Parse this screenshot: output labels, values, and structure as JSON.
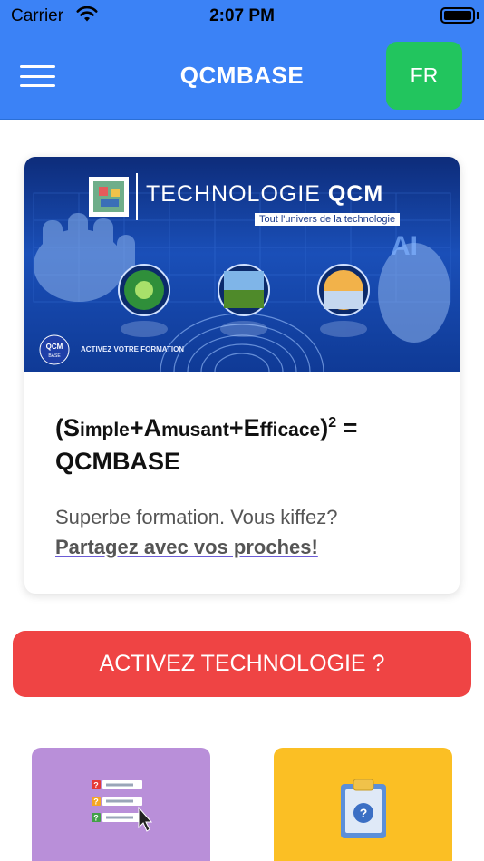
{
  "status_bar": {
    "carrier": "Carrier",
    "time": "2:07 PM",
    "battery_level": 1.0
  },
  "navbar": {
    "title": "QCMBASE",
    "menu_icon": "hamburger-menu-icon",
    "language_label": "FR",
    "language_color": "#22c55e",
    "background_color": "#3b82f6"
  },
  "card": {
    "banner": {
      "title_light": "TECHNOLOGIE ",
      "title_bold": "QCM",
      "subtitle": "Tout l'univers de la technologie",
      "cta": "ACTIVEZ VOTRE FORMATION",
      "badge_text": "AI"
    },
    "heading": {
      "open_paren": "(",
      "w1_cap": "S",
      "w1_rest": "imple",
      "plus1": "+",
      "w2_cap": "A",
      "w2_rest": "musant",
      "plus2": "+",
      "w3_cap": "E",
      "w3_rest": "fficace",
      "close_paren": ")",
      "exponent": "2",
      "equals": " =",
      "result": "QCMBASE"
    },
    "text": "Superbe formation. Vous kiffez?",
    "share_link": "Partagez avec vos proches!"
  },
  "activate_button": {
    "label": "ACTIVEZ TECHNOLOGIE ?",
    "color": "#ef4444"
  },
  "tiles": [
    {
      "icon": "question-list-icon",
      "color": "#b98fd9"
    },
    {
      "icon": "clipboard-question-icon",
      "color": "#fbbf24"
    }
  ]
}
